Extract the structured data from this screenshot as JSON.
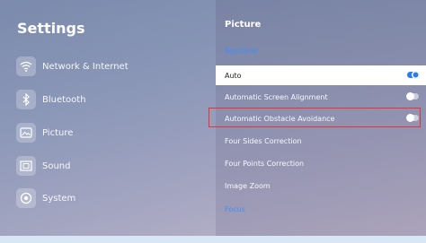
{
  "left": {
    "title": "Settings",
    "items": [
      {
        "label": "Network & Internet",
        "icon": "wifi-icon"
      },
      {
        "label": "Bluetooth",
        "icon": "bluetooth-icon"
      },
      {
        "label": "Picture",
        "icon": "picture-icon"
      },
      {
        "label": "Sound",
        "icon": "sound-icon"
      },
      {
        "label": "System",
        "icon": "system-icon"
      }
    ]
  },
  "right": {
    "title": "Picture",
    "section1": "Keystone",
    "rows": [
      {
        "label": "Auto",
        "toggle": "on"
      },
      {
        "label": "Automatic Screen Alignment",
        "toggle": "off"
      },
      {
        "label": "Automatic Obstacle Avoidance",
        "toggle": "off"
      },
      {
        "label": "Four Sides Correction"
      },
      {
        "label": "Four Points Correction"
      },
      {
        "label": "Image Zoom"
      }
    ],
    "section2": "Focus"
  },
  "colors": {
    "accent": "#2a7cf0",
    "highlight": "#e0353a",
    "section": "#3d8dff"
  }
}
